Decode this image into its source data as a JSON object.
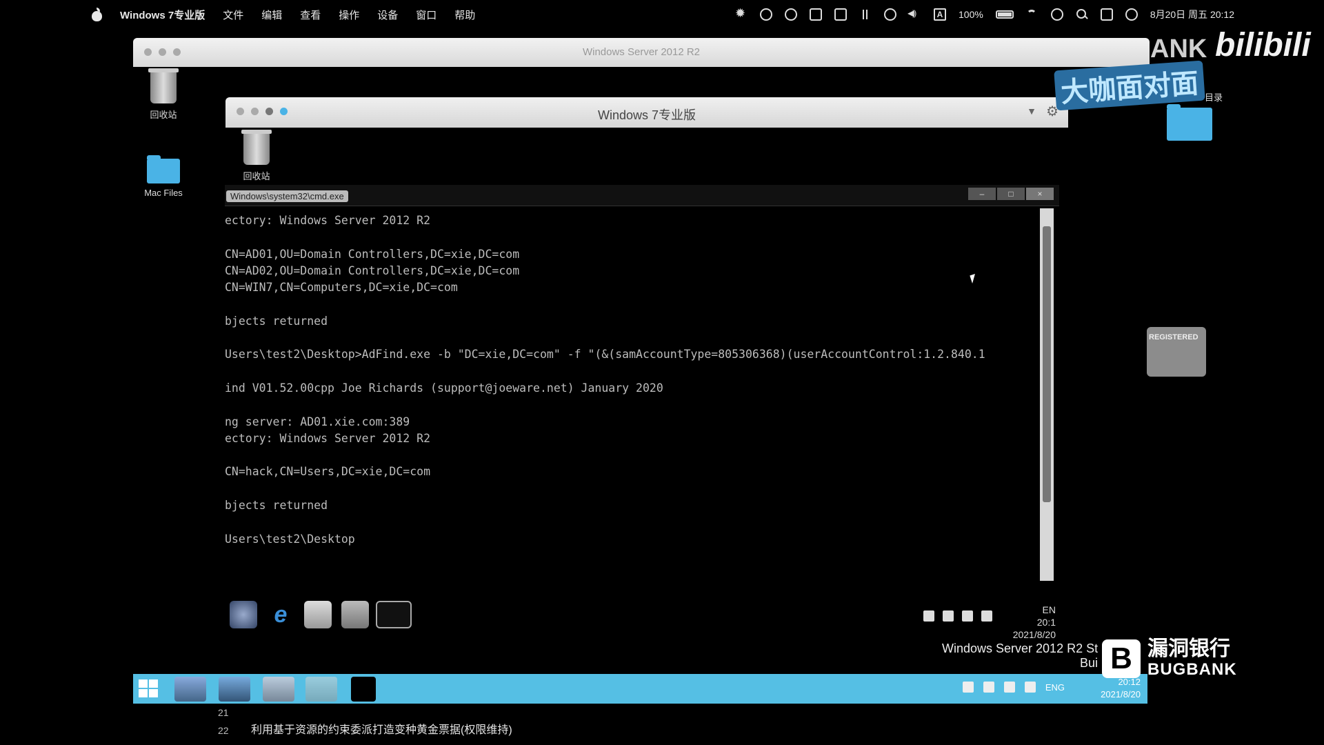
{
  "menubar": {
    "app_name": "Windows 7专业版",
    "items": [
      "文件",
      "编辑",
      "查看",
      "操作",
      "设备",
      "窗口",
      "帮助"
    ],
    "battery_percent": "100%",
    "datetime": "8月20日 周五 20:12"
  },
  "server_window": {
    "title": "Windows Server 2012 R2",
    "desktop_icons": [
      "回收站",
      "Mac Files"
    ],
    "watermark": "Windows Server 2012 R2 St",
    "watermark_line2": "Bui",
    "taskbar": {
      "lang": "ENG",
      "time": "20:12",
      "date": "2021/8/20"
    }
  },
  "win7_window": {
    "title": "Windows 7专业版",
    "desktop_icon": "回收站",
    "taskbar": {
      "lang": "EN",
      "time": "20:1",
      "date": "2021/8/20"
    }
  },
  "cmd": {
    "title": "Windows\\system32\\cmd.exe",
    "controls": [
      "–",
      "□",
      "×"
    ],
    "lines": [
      "ectory: Windows Server 2012 R2",
      "",
      "CN=AD01,OU=Domain Controllers,DC=xie,DC=com",
      "CN=AD02,OU=Domain Controllers,DC=xie,DC=com",
      "CN=WIN7,CN=Computers,DC=xie,DC=com",
      "",
      "bjects returned",
      "",
      "Users\\test2\\Desktop>AdFind.exe -b \"DC=xie,DC=com\" -f \"(&(samAccountType=805306368)(userAccountControl:1.2.840.1",
      "",
      "ind V01.52.00cpp Joe Richards (support@joeware.net) January 2020",
      "",
      "ng server: AD01.xie.com:389",
      "ectory: Windows Server 2012 R2",
      "",
      "CN=hack,CN=Users,DC=xie,DC=com",
      "",
      "bjects returned",
      "",
      "Users\\test2\\Desktop"
    ]
  },
  "right_desktop": {
    "label": "目录",
    "card_label": "REGISTERED"
  },
  "branding": {
    "bili_partial": "ANK",
    "bili": "bilibili",
    "series": "大咖面对面",
    "bugbank_cn": "漏洞银行",
    "bugbank_en": "BUGBANK"
  },
  "slide": {
    "numbers": [
      "21",
      "22"
    ],
    "caption": "利用基于资源的约束委派打造变种黄金票据(权限维持)"
  },
  "colors": {
    "server_taskbar": "#55bfe4",
    "folder": "#4ab3e6"
  }
}
